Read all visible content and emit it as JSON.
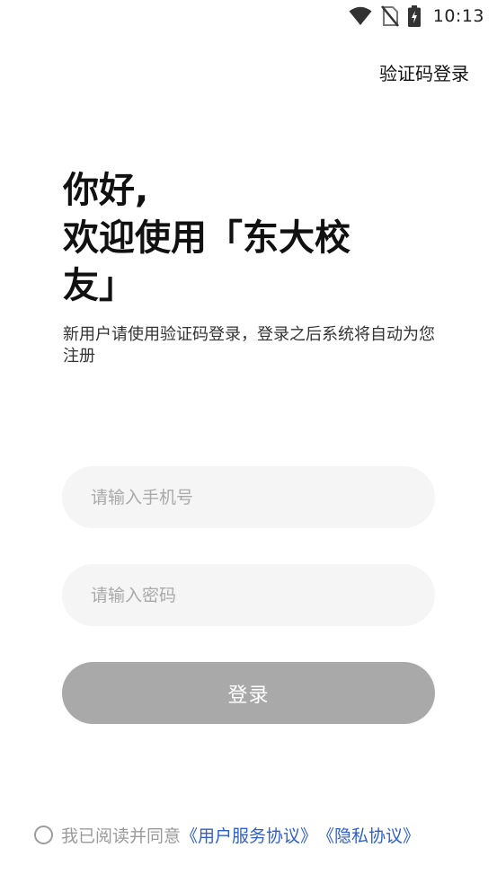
{
  "status_bar": {
    "time": "10:13",
    "icons": [
      "wifi-icon",
      "no-sim-icon",
      "battery-charging-icon"
    ]
  },
  "header": {
    "sms_login_label": "验证码登录"
  },
  "greeting": {
    "line1": "你好,",
    "line2": "欢迎使用「东大校",
    "line3": "友」"
  },
  "subtitle": "新用户请使用验证码登录，登录之后系统将自动为您注册",
  "form": {
    "phone": {
      "value": "",
      "placeholder": "请输入手机号"
    },
    "password": {
      "value": "",
      "placeholder": "请输入密码"
    },
    "login_label": "登录"
  },
  "agreement": {
    "checked": false,
    "text": "我已阅读并同意",
    "user_agreement_label": "《用户服务协议》",
    "privacy_label": "《隐私协议》"
  },
  "colors": {
    "field_bg": "#f5f5f5",
    "button_disabled": "#a9a9a9",
    "link": "#2f5fc9",
    "placeholder": "#a9a9a9"
  }
}
